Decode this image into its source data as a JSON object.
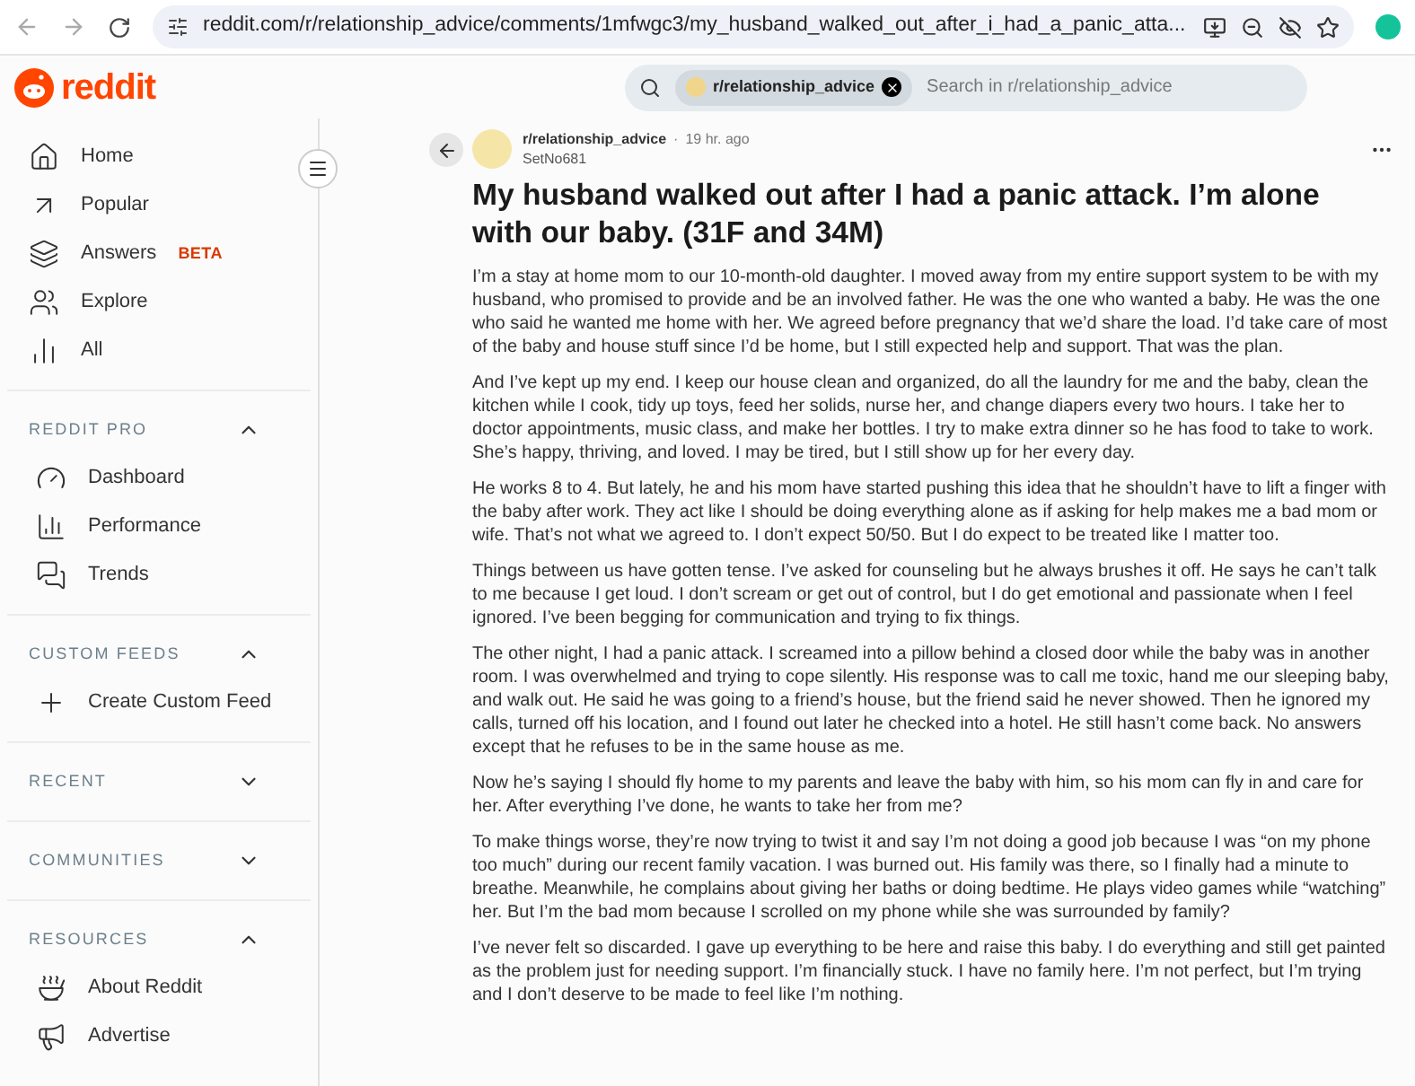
{
  "browser": {
    "url": "reddit.com/r/relationship_advice/comments/1mfwgc3/my_husband_walked_out_after_i_had_a_panic_atta..."
  },
  "header": {
    "logo_text": "reddit",
    "search": {
      "chip": "r/relationship_advice",
      "placeholder": "Search in r/relationship_advice"
    }
  },
  "sidebar": {
    "items": [
      {
        "label": "Home"
      },
      {
        "label": "Popular"
      },
      {
        "label": "Answers",
        "badge": "BETA"
      },
      {
        "label": "Explore"
      },
      {
        "label": "All"
      }
    ],
    "sections": [
      {
        "title": "REDDIT PRO",
        "expanded": true,
        "items": [
          {
            "label": "Dashboard"
          },
          {
            "label": "Performance"
          },
          {
            "label": "Trends"
          }
        ]
      },
      {
        "title": "CUSTOM FEEDS",
        "expanded": true,
        "items": [
          {
            "label": "Create Custom Feed"
          }
        ]
      },
      {
        "title": "RECENT",
        "expanded": false
      },
      {
        "title": "COMMUNITIES",
        "expanded": false
      },
      {
        "title": "RESOURCES",
        "expanded": true,
        "items": [
          {
            "label": "About Reddit"
          },
          {
            "label": "Advertise"
          }
        ]
      }
    ]
  },
  "post": {
    "subreddit": "r/relationship_advice",
    "separator": "·",
    "time": "19 hr. ago",
    "author": "SetNo681",
    "title": "My husband walked out after I had a panic attack. I’m alone with our baby. (31F and 34M)",
    "paragraphs": [
      "I’m a stay at home mom to our 10-month-old daughter. I moved away from my entire support system to be with my husband, who promised to provide and be an involved father. He was the one who wanted a baby. He was the one who said he wanted me home with her. We agreed before pregnancy that we’d share the load. I’d take care of most of the baby and house stuff since I’d be home, but I still expected help and support. That was the plan.",
      "And I’ve kept up my end. I keep our house clean and organized, do all the laundry for me and the baby, clean the kitchen while I cook, tidy up toys, feed her solids, nurse her, and change diapers every two hours. I take her to doctor appointments, music class, and make her bottles. I try to make extra dinner so he has food to take to work. She’s happy, thriving, and loved. I may be tired, but I still show up for her every day.",
      "He works 8 to 4. But lately, he and his mom have started pushing this idea that he shouldn’t have to lift a finger with the baby after work. They act like I should be doing everything alone as if asking for help makes me a bad mom or wife. That’s not what we agreed to. I don’t expect 50/50. But I do expect to be treated like I matter too.",
      "Things between us have gotten tense. I’ve asked for counseling but he always brushes it off. He says he can’t talk to me because I get loud. I don’t scream or get out of control, but I do get emotional and passionate when I feel ignored. I’ve been begging for communication and trying to fix things.",
      "The other night, I had a panic attack. I screamed into a pillow behind a closed door while the baby was in another room. I was overwhelmed and trying to cope silently. His response was to call me toxic, hand me our sleeping baby, and walk out. He said he was going to a friend’s house, but the friend said he never showed. Then he ignored my calls, turned off his location, and I found out later he checked into a hotel. He still hasn’t come back. No answers except that he refuses to be in the same house as me.",
      "Now he’s saying I should fly home to my parents and leave the baby with him, so his mom can fly in and care for her. After everything I’ve done, he wants to take her from me?",
      "To make things worse, they’re now trying to twist it and say I’m not doing a good job because I was “on my phone too much” during our recent family vacation. I was burned out. His family was there, so I finally had a minute to breathe. Meanwhile, he complains about giving her baths or doing bedtime. He plays video games while “watching” her. But I’m the bad mom because I scrolled on my phone while she was surrounded by family?",
      "I’ve never felt so discarded. I gave up everything to be here and raise this baby. I do everything and still get painted as the problem just for needing support. I’m financially stuck. I have no family here. I’m not perfect, but I’m trying and I don’t deserve to be made to feel like I’m nothing."
    ]
  }
}
